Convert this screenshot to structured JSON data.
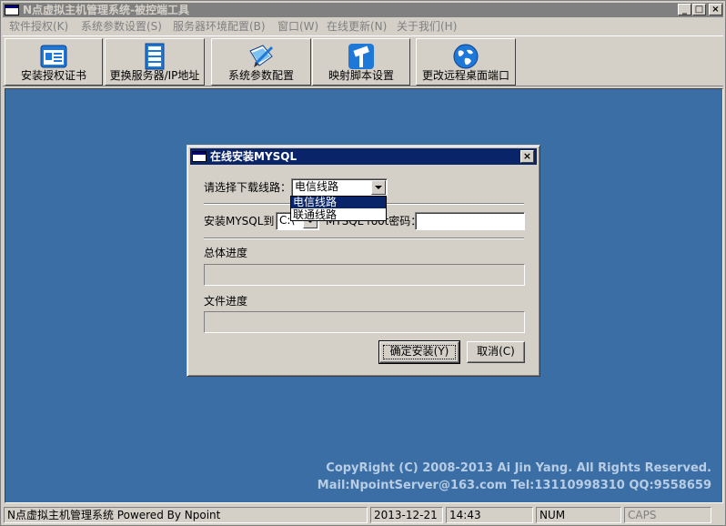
{
  "window": {
    "title": "N点虚拟主机管理系统-被控端工具",
    "minimize": "_",
    "maximize": "□",
    "close": "×"
  },
  "menu": [
    {
      "label": "软件授权(K)"
    },
    {
      "label": "系统参数设置(S)"
    },
    {
      "label": "服务器环境配置(B)"
    },
    {
      "label": "窗口(W)"
    },
    {
      "label": "在线更新(N)"
    },
    {
      "label": "关于我们(H)"
    }
  ],
  "toolbar": [
    {
      "label": "安装授权证书",
      "icon": "certificate-icon"
    },
    {
      "label": "更换服务器/IP地址",
      "icon": "server-icon"
    },
    {
      "label": "系统参数配置",
      "icon": "config-pen-icon"
    },
    {
      "label": "映射脚本设置",
      "icon": "hammer-icon"
    },
    {
      "label": "更改远程桌面端口",
      "icon": "globe-icon"
    }
  ],
  "footer": {
    "copyright": "CopyRight (C) 2008-2013 Ai Jin Yang. All Rights Reserved.",
    "contact": "Mail:NpointServer@163.com Tel:13110998310 QQ:9558659"
  },
  "statusbar": {
    "app": "N点虚拟主机管理系统 Powered By Npoint",
    "date": "2013-12-21",
    "time": "14:43",
    "num": "NUM",
    "caps": "CAPS"
  },
  "dialog": {
    "title": "在线安装MYSQL",
    "line_label": "请选择下载线路：",
    "line_selected": "电信线路",
    "line_options": [
      "电信线路",
      "联通线路"
    ],
    "install_label": "安装MYSQL到",
    "install_path": "C:\\",
    "password_label": "MYSQL root密码：",
    "password_value": "",
    "total_progress_label": "总体进度",
    "total_progress": 0,
    "file_progress_label": "文件进度",
    "file_progress": 0,
    "ok_button": "确定安装(Y)",
    "cancel_button": "取消(C)",
    "close": "×"
  },
  "colors": {
    "desktop": "#3a6ea5",
    "active_title": "#0a246a",
    "inactive_title": "#808080",
    "face": "#d4d0c8"
  }
}
